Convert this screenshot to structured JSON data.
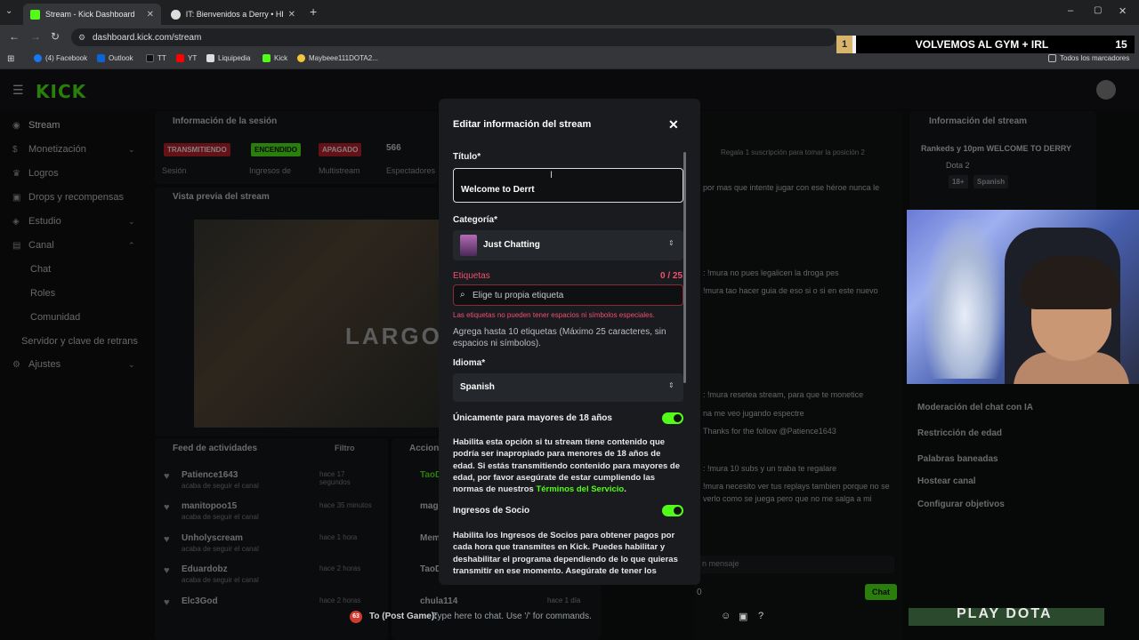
{
  "browser": {
    "tabs": [
      {
        "title": "Stream - Kick Dashboard",
        "active": true
      },
      {
        "title": "IT: Bienvenidos a Derry • HBO M",
        "active": false
      }
    ],
    "url": "dashboard.kick.com/stream",
    "bookmarks": [
      "(4) Facebook",
      "Outlook",
      "TT",
      "YT",
      "Liquipedia",
      "Kick",
      "Maybeee111DOTA2..."
    ],
    "all_bookmarks": "Todos los marcadores"
  },
  "banner": {
    "rank": "1",
    "text": "VOLVEMOS AL GYM + IRL",
    "count": "15"
  },
  "app": {
    "logo": "KICK",
    "sidebar": {
      "items": [
        {
          "label": "Stream",
          "icon": "broadcast-icon"
        },
        {
          "label": "Monetización",
          "icon": "money-icon"
        },
        {
          "label": "Logros",
          "icon": "trophy-icon"
        },
        {
          "label": "Drops y recompensas",
          "icon": "gift-icon"
        },
        {
          "label": "Estudio",
          "icon": "studio-icon"
        },
        {
          "label": "Canal",
          "icon": "channel-icon"
        }
      ],
      "sub": [
        "Chat",
        "Roles",
        "Comunidad",
        "Servidor y clave de retrans"
      ],
      "settings": "Ajustes"
    },
    "session": {
      "title": "Información de la sesión",
      "badges": [
        "TRANSMITIENDO",
        "ENCENDIDO",
        "APAGADO"
      ],
      "labels": [
        "Sesión",
        "Ingresos de",
        "Multistream",
        "Espectadores"
      ],
      "viewers": "566"
    },
    "preview": {
      "title": "Vista previa del stream",
      "overlay": "LARGO"
    },
    "feed": {
      "title": "Feed de actividades",
      "filter": "Filtro",
      "items": [
        {
          "name": "Patience1643",
          "sub": "acaba de seguir el canal",
          "time": "hace 17 segundos"
        },
        {
          "name": "manitopoo15",
          "sub": "acaba de seguir el canal",
          "time": "hace 35 minutos"
        },
        {
          "name": "Unholyscream",
          "sub": "acaba de seguir el canal",
          "time": "hace 1 hora"
        },
        {
          "name": "Eduardobz",
          "sub": "acaba de seguir el canal",
          "time": "hace 2 horas"
        },
        {
          "name": "Elc3God",
          "sub": "",
          "time": "hace 2 horas"
        }
      ]
    },
    "actions": {
      "title": "Accion",
      "items": [
        "TaoD",
        "mag",
        "Mem",
        "TaoD",
        "chula114"
      ],
      "time_last": "hace 1 día"
    },
    "chat": {
      "top": "Regala 1 suscripción para tomar la posición 2",
      "lines": [
        "por mas que intente jugar con ese héroe nunca le",
        ": !mura no pues legalicen la droga pes",
        "!mura tao hacer guia de eso si o si en este nuevo",
        ": !mura resetea stream, para que te monetice",
        "na me veo jugando espectre",
        "Thanks for the follow @Patience1643",
        ": !mura 10 subs y un traba te regalare",
        "!mura necesito ver tus replays tambien porque no se",
        "verlo como se juega pero que no me salga a mi"
      ],
      "placeholder": "n mensaje",
      "count": "0",
      "send": "Chat"
    },
    "right_panel": {
      "title": "Información del stream",
      "stream_title": "Rankeds y 10pm WELCOME TO DERRY",
      "category": "Dota 2",
      "tags": [
        "18+",
        "Spanish"
      ],
      "items": [
        "Moderación del chat con IA",
        "Restricción de edad",
        "Palabras baneadas",
        "Hostear canal",
        "Configurar objetivos"
      ]
    },
    "bottom": {
      "count": "63",
      "prefix": "To (Post Game):",
      "hint": "Type here to chat. Use '/' for commands.",
      "play": "PLAY DOTA"
    }
  },
  "modal": {
    "title": "Editar información del stream",
    "title_label": "Título*",
    "title_value": "Welcome to Derrt",
    "category_label": "Categoría*",
    "category_value": "Just Chatting",
    "tags_label": "Etiquetas",
    "tags_count": "0 / 25",
    "tags_placeholder": "Elige tu propia etiqueta",
    "tags_error": "Las etiquetas no pueden tener espacios ni símbolos especiales.",
    "tags_help": "Agrega hasta 10 etiquetas (Máximo 25 caracteres, sin espacios ni símbolos).",
    "language_label": "Idioma*",
    "language_value": "Spanish",
    "adult_label": "Únicamente para mayores de 18 años",
    "adult_text_1": "Habilita esta opción si tu stream tiene contenido que podría ser inapropiado para menores de 18 años de edad. Si estás transmitiendo contenido para mayores de edad, por favor asegúrate de estar cumpliendo las normas de nuestros",
    "adult_link": "Términos del Servicio",
    "adult_text_end": ".",
    "partner_label": "Ingresos de Socio",
    "partner_text": "Habilita los Ingresos de Socios para obtener pagos por cada hora que transmites en Kick. Puedes habilitar y deshabilitar el programa dependiendo de lo que quieras transmitir en ese momento. Asegúrate de tener los",
    "adult_enabled": true,
    "partner_enabled": true
  },
  "colors": {
    "accent": "#53fc18",
    "error": "#f0506e",
    "modal_bg": "#191b1f"
  }
}
